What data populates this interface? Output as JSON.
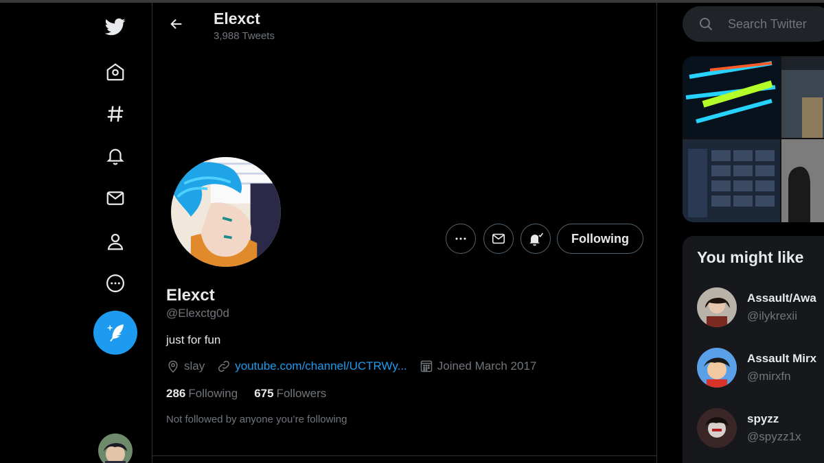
{
  "nav": {
    "items": [
      {
        "icon": "twitter-bird-icon"
      },
      {
        "icon": "home-icon"
      },
      {
        "icon": "explore-hashtag-icon"
      },
      {
        "icon": "notifications-bell-icon"
      },
      {
        "icon": "messages-mail-icon"
      },
      {
        "icon": "profile-person-icon"
      },
      {
        "icon": "more-circle-icon"
      }
    ],
    "compose_icon": "compose-feather-icon"
  },
  "header": {
    "name": "Elexct",
    "tweet_count": "3,988 Tweets"
  },
  "profile": {
    "name": "Elexct",
    "handle": "@Elexctg0d",
    "bio": "just for fun",
    "location": "slay",
    "website": "youtube.com/channel/UCTRWy...",
    "joined": "Joined March 2017",
    "following_count": "286",
    "following_label": "Following",
    "followers_count": "675",
    "followers_label": "Followers",
    "not_followed_note": "Not followed by anyone you’re following",
    "follow_button_label": "Following"
  },
  "search": {
    "placeholder": "Search Twitter"
  },
  "who_to_follow": {
    "title": "You might like",
    "suggestions": [
      {
        "name": "Assault/Awa",
        "handle": "@ilykrexii"
      },
      {
        "name": "Assault Mirx",
        "handle": "@mirxfn"
      },
      {
        "name": "spyzz",
        "handle": "@spyzz1x"
      }
    ]
  },
  "colors": {
    "accent": "#1d9bf0",
    "background": "#000000",
    "muted_text": "#71767b",
    "border": "#2f3336"
  }
}
